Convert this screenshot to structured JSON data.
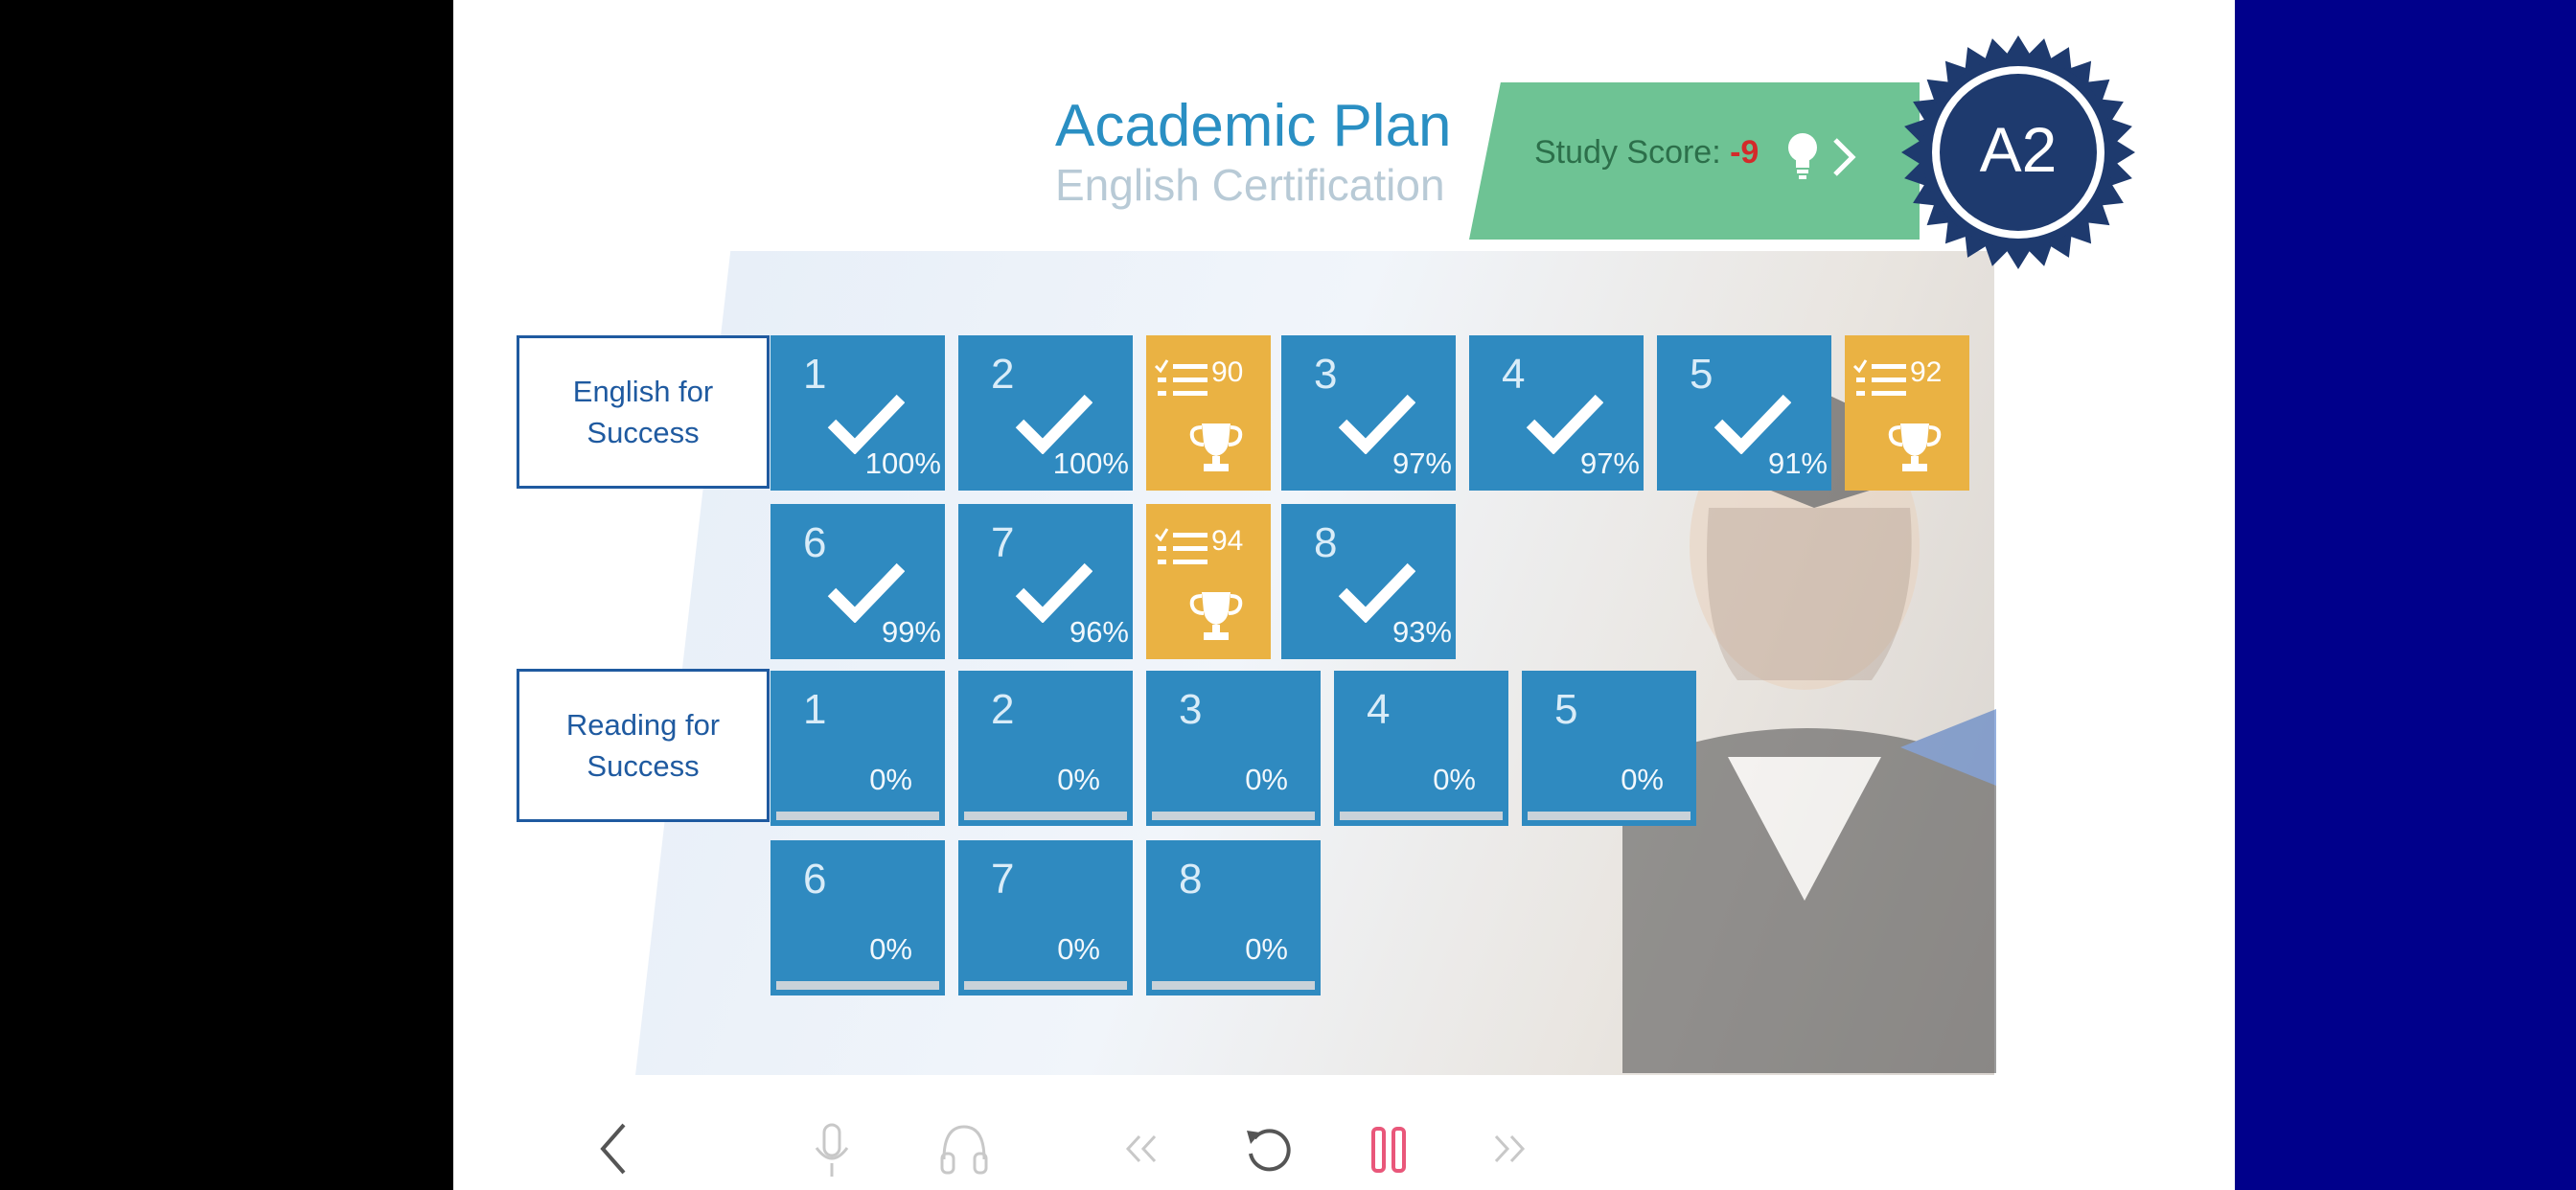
{
  "header": {
    "title": "Academic Plan",
    "subtitle": "English Certification"
  },
  "score": {
    "label": "Study Score:",
    "value": "-9"
  },
  "level": {
    "badge": "A2"
  },
  "courses": [
    {
      "label": "English for Success",
      "tiles": [
        {
          "type": "lesson",
          "num": "1",
          "pct": "100%"
        },
        {
          "type": "lesson",
          "num": "2",
          "pct": "100%"
        },
        {
          "type": "exam",
          "score": "90"
        },
        {
          "type": "lesson",
          "num": "3",
          "pct": "97%"
        },
        {
          "type": "lesson",
          "num": "4",
          "pct": "97%"
        },
        {
          "type": "lesson",
          "num": "5",
          "pct": "91%"
        },
        {
          "type": "exam",
          "score": "92"
        },
        {
          "type": "lesson",
          "num": "6",
          "pct": "99%"
        },
        {
          "type": "lesson",
          "num": "7",
          "pct": "96%"
        },
        {
          "type": "exam",
          "score": "94"
        },
        {
          "type": "lesson",
          "num": "8",
          "pct": "93%"
        }
      ]
    },
    {
      "label": "Reading for Success",
      "tiles": [
        {
          "type": "progress",
          "num": "1",
          "pct": "0%"
        },
        {
          "type": "progress",
          "num": "2",
          "pct": "0%"
        },
        {
          "type": "progress",
          "num": "3",
          "pct": "0%"
        },
        {
          "type": "progress",
          "num": "4",
          "pct": "0%"
        },
        {
          "type": "progress",
          "num": "5",
          "pct": "0%"
        },
        {
          "type": "progress",
          "num": "6",
          "pct": "0%"
        },
        {
          "type": "progress",
          "num": "7",
          "pct": "0%"
        },
        {
          "type": "progress",
          "num": "8",
          "pct": "0%"
        }
      ]
    }
  ],
  "toolbar": [
    "back-icon",
    "microphone-icon",
    "headphones-icon",
    "rewind-icon",
    "replay-icon",
    "pause-icon",
    "forward-icon"
  ],
  "colors": {
    "accent": "#2a8fc3",
    "tile": "#2f8ac0",
    "exam": "#eab243",
    "score_banner": "#6ec394",
    "score_negative": "#d42a2a",
    "badge": "#1e3a6e",
    "pause": "#e9577a"
  }
}
